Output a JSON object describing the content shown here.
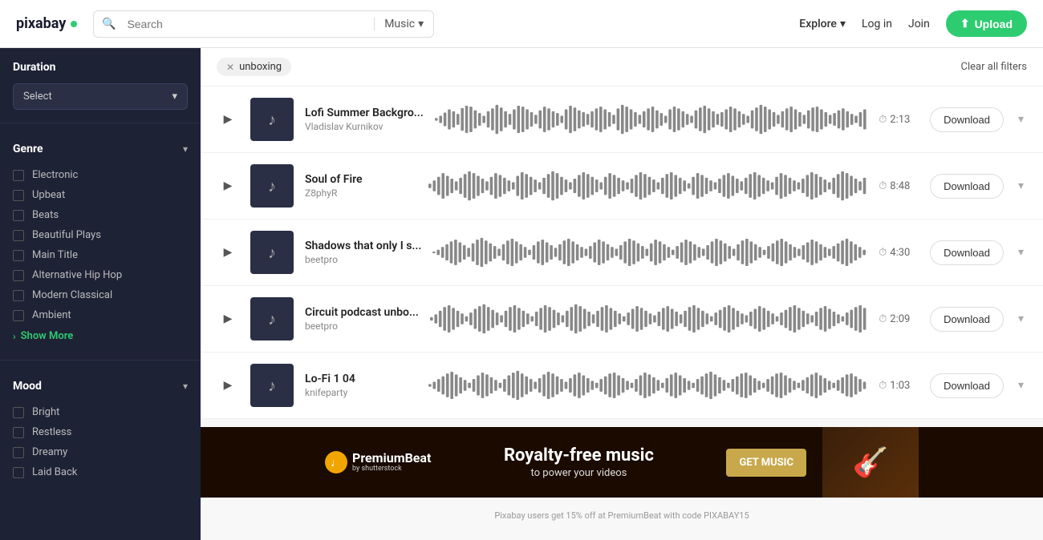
{
  "header": {
    "logo": "pixabay",
    "search_placeholder": "Search",
    "search_type": "Music",
    "explore_label": "Explore",
    "login_label": "Log in",
    "join_label": "Join",
    "upload_label": "Upload"
  },
  "sidebar": {
    "duration_section": "Duration",
    "duration_select": "Select",
    "genre_section": "Genre",
    "genre_items": [
      "Electronic",
      "Upbeat",
      "Beats",
      "Beautiful Plays",
      "Main Title",
      "Alternative Hip Hop",
      "Modern Classical",
      "Ambient"
    ],
    "show_more_label": "Show More",
    "mood_section": "Mood",
    "mood_items": [
      "Bright",
      "Restless",
      "Dreamy",
      "Laid Back"
    ]
  },
  "filter_bar": {
    "active_filter": "unboxing",
    "clear_label": "Clear all filters"
  },
  "tracks": [
    {
      "title": "Lofi Summer Backgro...",
      "artist": "Vladislav Kurnikov",
      "duration": "2:13"
    },
    {
      "title": "Soul of Fire",
      "artist": "Z8phyR",
      "duration": "8:48"
    },
    {
      "title": "Shadows that only I s...",
      "artist": "beetpro",
      "duration": "4:30"
    },
    {
      "title": "Circuit podcast unbo...",
      "artist": "beetpro",
      "duration": "2:09"
    },
    {
      "title": "Lo-Fi 1 04",
      "artist": "knifeparty",
      "duration": "1:03"
    }
  ],
  "download_label": "Download",
  "ad": {
    "logo_name": "PremiumBeat",
    "logo_sub": "by shutterstock",
    "headline": "Royalty-free music",
    "sub": "to power your videos",
    "cta": "GET MUSIC",
    "footer": "Pixabay users get 15% off at PremiumBeat with code PIXABAY15"
  },
  "waveforms": [
    [
      3,
      8,
      15,
      22,
      18,
      12,
      25,
      30,
      28,
      20,
      14,
      8,
      18,
      24,
      32,
      26,
      18,
      12,
      22,
      30,
      28,
      22,
      16,
      10,
      20,
      28,
      24,
      18,
      14,
      8,
      22,
      30,
      26,
      20,
      16,
      12,
      18,
      24,
      28,
      22,
      16,
      10,
      24,
      32,
      28,
      22,
      16,
      10,
      18,
      24,
      28,
      20,
      14,
      8,
      22,
      28,
      24,
      18,
      12,
      8,
      20,
      26,
      30,
      24,
      18,
      12,
      16,
      22,
      28,
      24,
      18,
      12,
      8,
      20,
      26,
      32,
      28,
      22,
      16,
      10,
      18,
      24,
      28,
      22,
      16,
      10,
      20,
      26,
      28,
      22,
      16,
      10,
      14,
      20,
      24,
      18,
      12,
      8,
      16,
      22
    ],
    [
      5,
      12,
      20,
      28,
      22,
      16,
      10,
      18,
      26,
      32,
      28,
      22,
      16,
      10,
      20,
      28,
      24,
      18,
      12,
      8,
      22,
      30,
      26,
      20,
      14,
      8,
      18,
      26,
      32,
      28,
      20,
      14,
      8,
      16,
      24,
      30,
      26,
      20,
      14,
      8,
      20,
      28,
      24,
      18,
      12,
      8,
      16,
      24,
      30,
      26,
      20,
      14,
      8,
      18,
      26,
      30,
      24,
      18,
      12,
      6,
      20,
      28,
      24,
      18,
      12,
      8,
      16,
      24,
      28,
      22,
      16,
      10,
      18,
      26,
      30,
      24,
      18,
      12,
      8,
      20,
      28,
      24,
      18,
      12,
      8,
      16,
      24,
      30,
      26,
      20,
      14,
      8,
      18,
      26,
      32,
      28,
      22,
      16,
      10,
      18
    ],
    [
      2,
      6,
      12,
      18,
      24,
      28,
      22,
      16,
      10,
      20,
      28,
      32,
      26,
      20,
      14,
      8,
      18,
      26,
      30,
      24,
      18,
      12,
      6,
      16,
      24,
      28,
      22,
      16,
      10,
      18,
      26,
      30,
      24,
      18,
      12,
      8,
      14,
      22,
      28,
      24,
      18,
      12,
      8,
      16,
      24,
      30,
      26,
      20,
      14,
      8,
      20,
      28,
      24,
      18,
      12,
      6,
      14,
      22,
      28,
      24,
      18,
      12,
      8,
      16,
      24,
      30,
      26,
      20,
      14,
      8,
      18,
      26,
      30,
      24,
      18,
      12,
      6,
      14,
      20,
      26,
      30,
      24,
      18,
      12,
      8,
      16,
      22,
      28,
      24,
      18,
      12,
      8,
      14,
      20,
      26,
      30,
      24,
      18,
      12,
      6
    ],
    [
      4,
      10,
      18,
      26,
      30,
      24,
      18,
      12,
      6,
      14,
      22,
      28,
      32,
      26,
      20,
      14,
      8,
      18,
      26,
      30,
      24,
      18,
      12,
      6,
      16,
      24,
      30,
      26,
      20,
      14,
      8,
      18,
      26,
      32,
      28,
      22,
      16,
      10,
      18,
      26,
      30,
      24,
      18,
      12,
      6,
      14,
      22,
      28,
      24,
      18,
      12,
      8,
      16,
      24,
      28,
      22,
      16,
      10,
      18,
      26,
      30,
      24,
      18,
      12,
      6,
      14,
      20,
      26,
      30,
      24,
      18,
      12,
      8,
      16,
      22,
      28,
      24,
      18,
      12,
      6,
      14,
      20,
      26,
      30,
      24,
      18,
      12,
      8,
      16,
      24,
      28,
      22,
      16,
      10,
      6,
      14,
      20,
      26,
      30,
      24
    ],
    [
      3,
      8,
      14,
      20,
      26,
      30,
      24,
      18,
      12,
      6,
      14,
      22,
      28,
      24,
      18,
      12,
      6,
      14,
      22,
      28,
      32,
      26,
      20,
      14,
      8,
      16,
      24,
      30,
      26,
      20,
      14,
      8,
      16,
      24,
      28,
      22,
      16,
      10,
      6,
      14,
      20,
      26,
      28,
      22,
      16,
      10,
      6,
      14,
      22,
      28,
      24,
      18,
      12,
      6,
      16,
      24,
      28,
      22,
      16,
      10,
      6,
      14,
      20,
      26,
      30,
      24,
      18,
      12,
      6,
      14,
      20,
      26,
      28,
      22,
      16,
      10,
      6,
      14,
      20,
      26,
      28,
      22,
      16,
      10,
      6,
      12,
      18,
      24,
      28,
      22,
      16,
      10,
      6,
      12,
      18,
      24,
      26,
      20,
      14,
      8
    ]
  ]
}
